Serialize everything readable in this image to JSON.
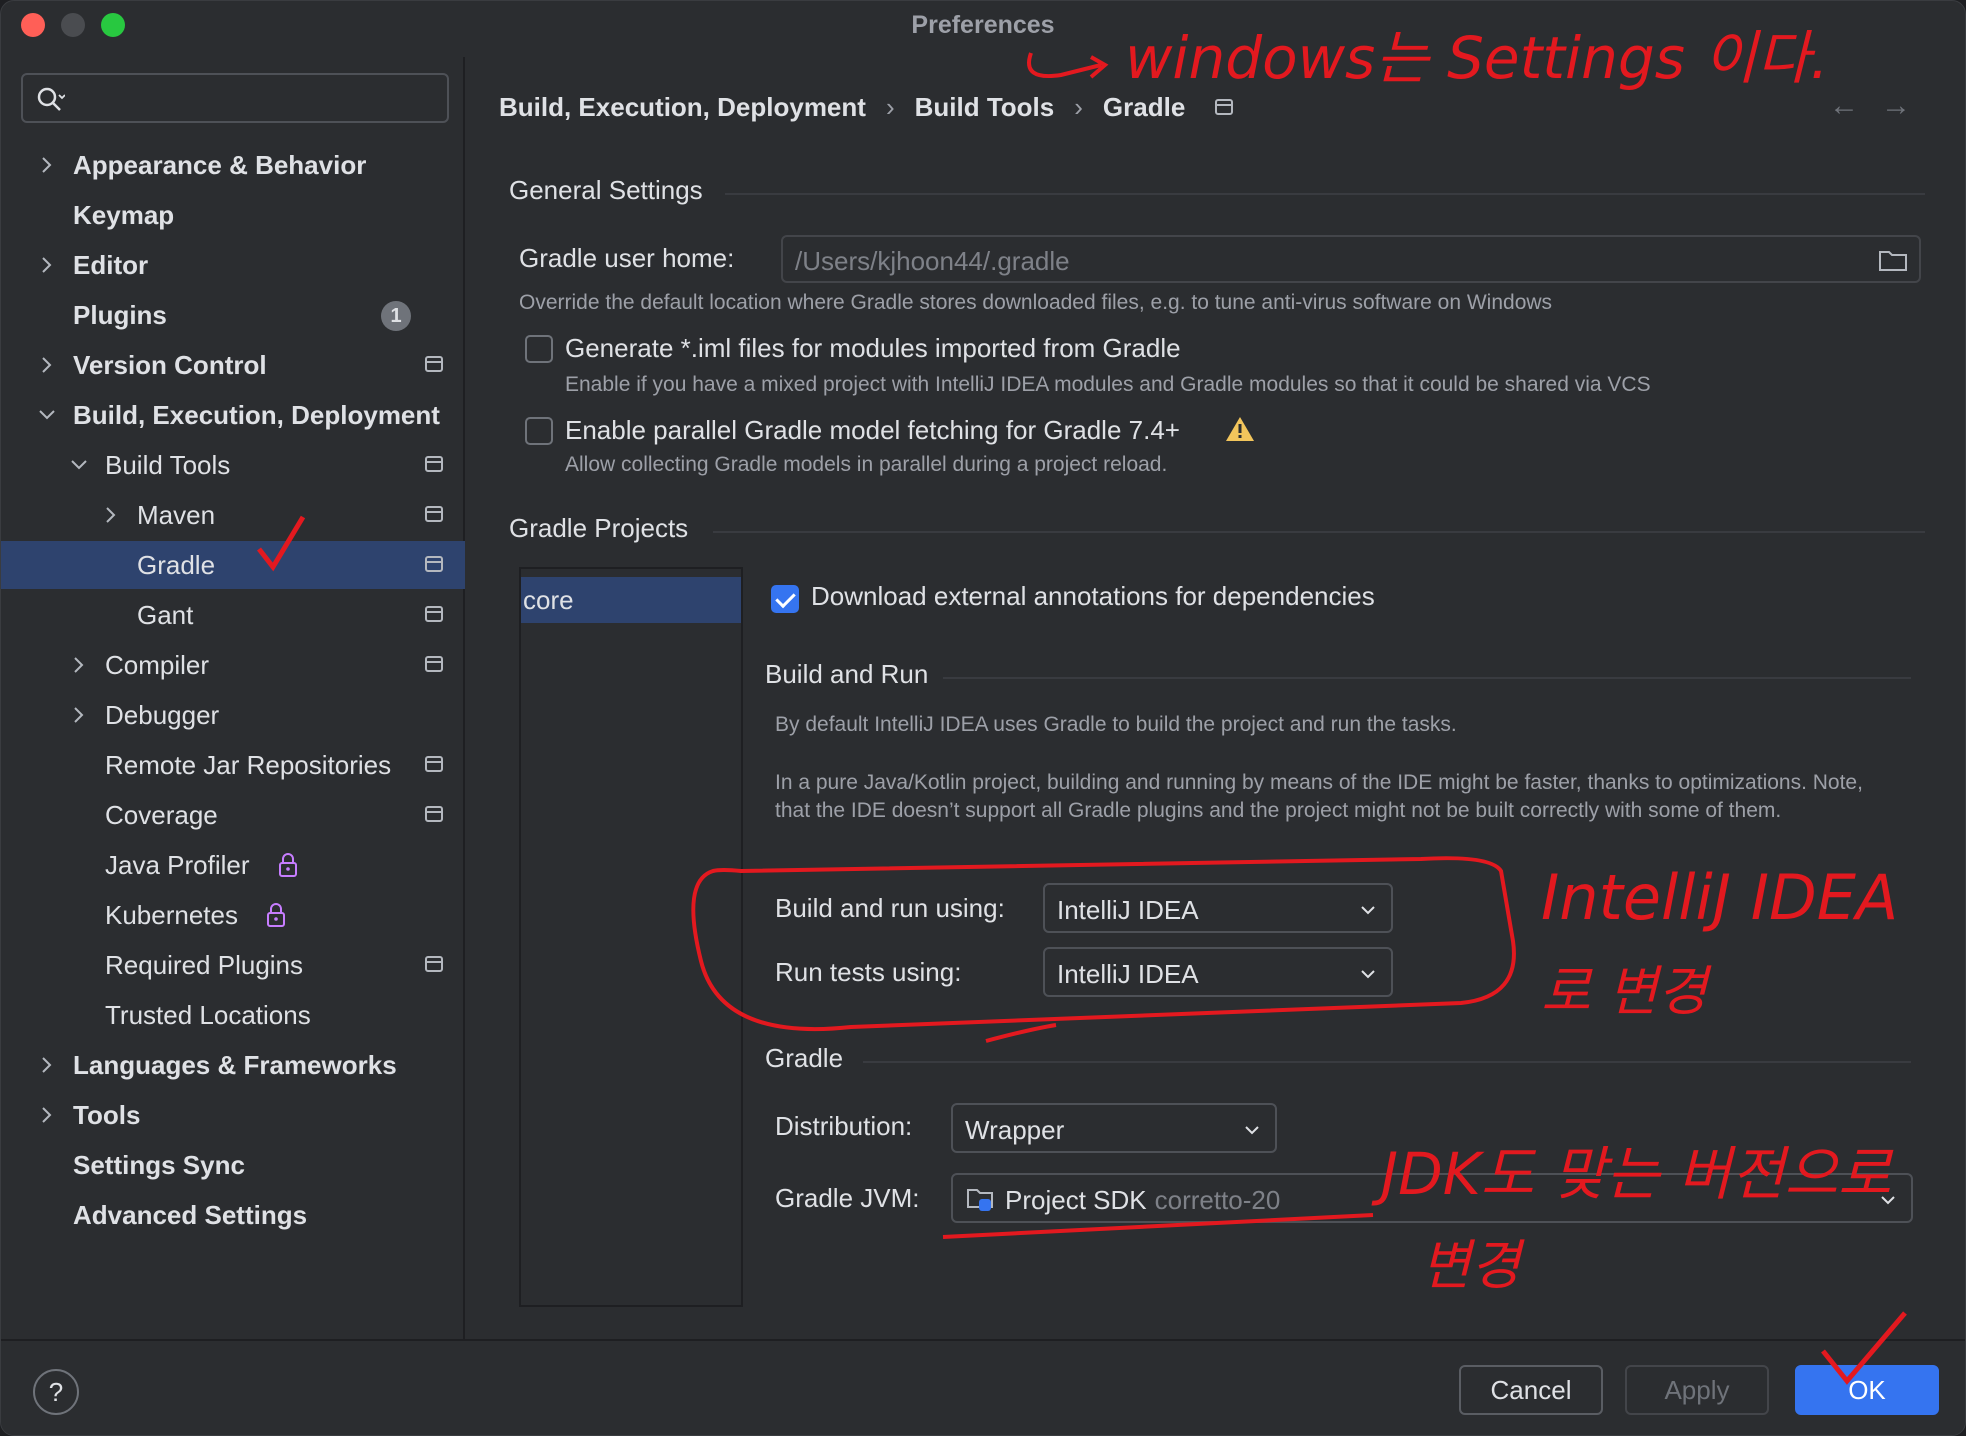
{
  "window": {
    "title": "Preferences"
  },
  "search": {
    "placeholder": ""
  },
  "sidebar": {
    "items": [
      {
        "label": "Appearance & Behavior"
      },
      {
        "label": "Keymap"
      },
      {
        "label": "Editor"
      },
      {
        "label": "Plugins",
        "badge": "1"
      },
      {
        "label": "Version Control"
      },
      {
        "label": "Build, Execution, Deployment"
      },
      {
        "label": "Build Tools"
      },
      {
        "label": "Maven"
      },
      {
        "label": "Gradle"
      },
      {
        "label": "Gant"
      },
      {
        "label": "Compiler"
      },
      {
        "label": "Debugger"
      },
      {
        "label": "Remote Jar Repositories"
      },
      {
        "label": "Coverage"
      },
      {
        "label": "Java Profiler"
      },
      {
        "label": "Kubernetes"
      },
      {
        "label": "Required Plugins"
      },
      {
        "label": "Trusted Locations"
      },
      {
        "label": "Languages & Frameworks"
      },
      {
        "label": "Tools"
      },
      {
        "label": "Settings Sync"
      },
      {
        "label": "Advanced Settings"
      }
    ]
  },
  "breadcrumb": {
    "items": [
      "Build, Execution, Deployment",
      "Build Tools",
      "Gradle"
    ],
    "separator": "›",
    "back": "←",
    "forward": "→"
  },
  "general": {
    "title": "General Settings",
    "user_home_label": "Gradle user home:",
    "user_home_value": "/Users/kjhoon44/.gradle",
    "user_home_hint": "Override the default location where Gradle stores downloaded files, e.g. to tune anti-virus software on Windows",
    "iml_label": "Generate *.iml files for modules imported from Gradle",
    "iml_checked": false,
    "iml_hint": "Enable if you have a mixed project with IntelliJ IDEA modules and Gradle modules so that it could be shared via VCS",
    "parallel_label": "Enable parallel Gradle model fetching for Gradle 7.4+",
    "parallel_checked": false,
    "parallel_hint": "Allow collecting Gradle models in parallel during a project reload."
  },
  "projects": {
    "title": "Gradle Projects",
    "list": [
      "core"
    ],
    "download_annotations_label": "Download external annotations for dependencies",
    "download_annotations_checked": true
  },
  "build_run": {
    "title": "Build and Run",
    "hint1": "By default IntelliJ IDEA uses Gradle to build the project and run the tasks.",
    "hint2": "In a pure Java/Kotlin project, building and running by means of the IDE might be faster, thanks to optimizations. Note, that the IDE doesn’t support all Gradle plugins and the project might not be built correctly with some of them.",
    "build_label": "Build and run using:",
    "build_value": "IntelliJ IDEA",
    "tests_label": "Run tests using:",
    "tests_value": "IntelliJ IDEA"
  },
  "gradle": {
    "title": "Gradle",
    "distribution_label": "Distribution:",
    "distribution_value": "Wrapper",
    "jvm_label": "Gradle JVM:",
    "jvm_value": "Project SDK",
    "jvm_sub": "corretto-20"
  },
  "footer": {
    "help": "?",
    "cancel": "Cancel",
    "apply": "Apply",
    "ok": "OK"
  },
  "annotations": {
    "top": "windows는 Settings 이다.",
    "intellij": "IntelliJ IDEA",
    "intellij_sub": "로 변경",
    "jdk": "JDK도 맞는 버전으로",
    "jdk_sub": "변경"
  },
  "colors": {
    "accent": "#3574f0",
    "selection": "#2e436e",
    "annotation": "#e3191f",
    "warning": "#f2c55c"
  }
}
